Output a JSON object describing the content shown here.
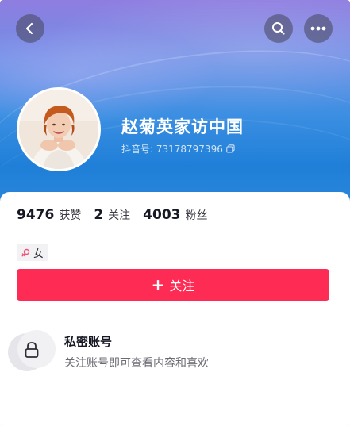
{
  "header": {
    "back_icon": "chevron-left-icon",
    "search_icon": "search-icon",
    "more_icon": "more-horizontal-icon"
  },
  "profile": {
    "name": "赵菊英家访中国",
    "douyin_id": "抖音号: 73178797396",
    "copy_icon": "copy-icon"
  },
  "stats": [
    {
      "value": "9476",
      "label": "获赞"
    },
    {
      "value": "2",
      "label": "关注"
    },
    {
      "value": "4003",
      "label": "粉丝"
    }
  ],
  "gender": {
    "icon": "female-icon",
    "label": "女"
  },
  "follow_button": {
    "icon": "plus-icon",
    "label": "关注"
  },
  "private_account": {
    "icon": "lock-icon",
    "title": "私密账号",
    "description": "关注账号即可查看内容和喜欢"
  },
  "colors": {
    "follow_red": "#fe2c55",
    "banner_blue": "#1f7fd8"
  }
}
